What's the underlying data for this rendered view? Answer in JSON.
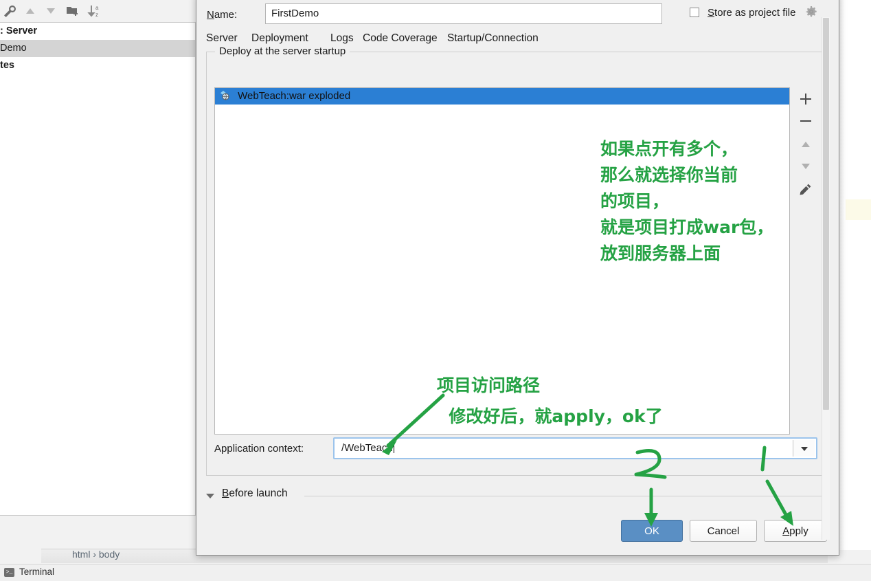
{
  "background": {
    "breadcrumb": "html  ›  body",
    "terminal_label": "Terminal",
    "terminal_icon": "terminal-icon"
  },
  "left_panel": {
    "toolbar_icons": [
      "wrench-icon",
      "arrow-up-icon",
      "arrow-down-icon",
      "new-folder-icon",
      "sort-az-icon"
    ],
    "tree_items": [
      {
        "label": ": Server",
        "bold": true,
        "selected": false
      },
      {
        "label": "Demo",
        "bold": false,
        "selected": true
      },
      {
        "label": "tes",
        "bold": true,
        "selected": false
      }
    ]
  },
  "dialog": {
    "name_label": "Name:",
    "name_label_mnemonic": "N",
    "name_value": "FirstDemo",
    "name_placeholder": "",
    "store_as_project_file": {
      "label": "Store as project file",
      "mnemonic": "S",
      "checked": false,
      "gear_icon": "gear-icon"
    },
    "tabs": [
      {
        "label": "Server",
        "active": false
      },
      {
        "label": "Deployment",
        "active": true
      },
      {
        "label": "Logs",
        "active": false
      },
      {
        "label": "Code Coverage",
        "active": false
      },
      {
        "label": "Startup/Connection",
        "active": false
      }
    ],
    "deploy_group_title": "Deploy at the server startup",
    "artifact_list": [
      {
        "label": "WebTeach:war exploded",
        "icon": "artifact-war-icon",
        "selected": true
      }
    ],
    "side_buttons": [
      {
        "name": "add-button",
        "glyph": "+"
      },
      {
        "name": "remove-button",
        "glyph": "−"
      },
      {
        "name": "move-up-button",
        "glyph": "▲"
      },
      {
        "name": "move-down-button",
        "glyph": "▼"
      },
      {
        "name": "edit-button",
        "glyph": "✎"
      }
    ],
    "application_context": {
      "label": "Application context:",
      "value": "/WebTeach",
      "placeholder": "",
      "dropdown_icon": "chevron-down-icon"
    },
    "before_launch": {
      "label": "Before launch",
      "mnemonic": "B",
      "expanded": true
    },
    "buttons": [
      {
        "name": "ok-button",
        "label": "OK",
        "primary": true
      },
      {
        "name": "cancel-button",
        "label": "Cancel",
        "primary": false
      },
      {
        "name": "apply-button",
        "label": "Apply",
        "primary": false,
        "mnemonic": "A"
      }
    ]
  },
  "annotations": {
    "color": "#25a244",
    "note_1": "如果点开有多个，\n那么就选择你当前\n的项目，\n就是项目打成war包，\n放到服务器上面",
    "note_2": "项目访问路径\n  修改好后，就apply，ok了",
    "arrows": [
      "arrow-to-application-context",
      "arrow-to-ok-button",
      "arrow-to-apply-button"
    ]
  },
  "colors": {
    "accent_blue": "#3d7bbf",
    "selection_blue": "#2b7fd4",
    "annotation_green": "#25a244",
    "dialog_bg": "#f0f0f0"
  }
}
